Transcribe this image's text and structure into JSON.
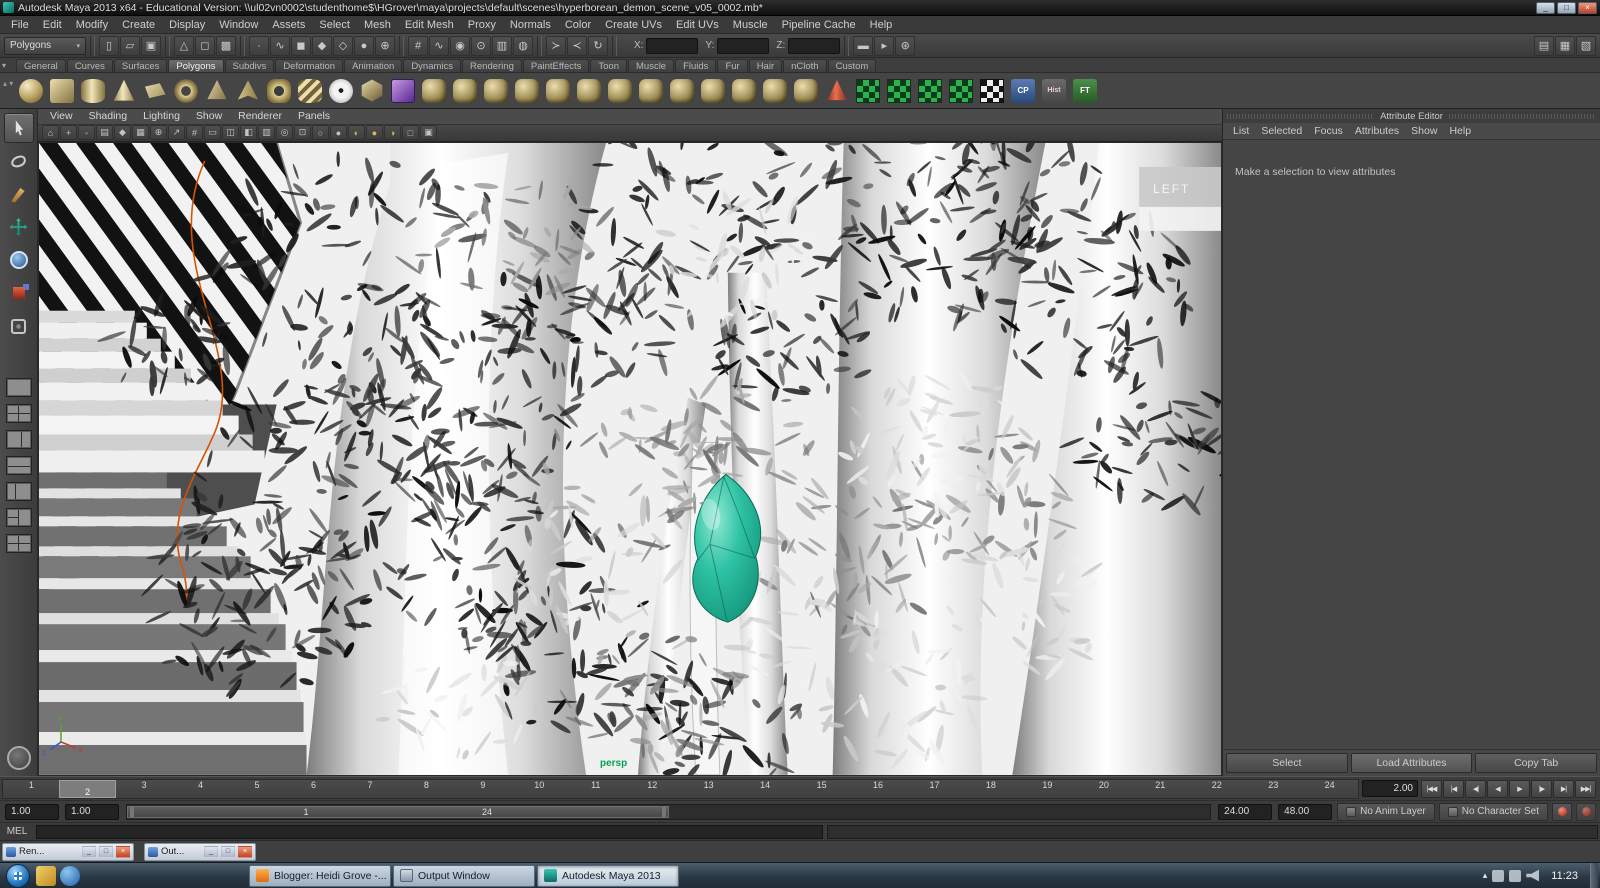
{
  "titlebar": {
    "title": "Autodesk Maya 2013 x64 - Educational Version: \\\\ul02vn0002\\studenthome$\\HGrover\\maya\\projects\\default\\scenes\\hyperborean_demon_scene_v05_0002.mb*",
    "minimize": "_",
    "maximize": "□",
    "close": "×"
  },
  "menubar": {
    "items": [
      "File",
      "Edit",
      "Modify",
      "Create",
      "Display",
      "Window",
      "Assets",
      "Select",
      "Mesh",
      "Edit Mesh",
      "Proxy",
      "Normals",
      "Color",
      "Create UVs",
      "Edit UVs",
      "Muscle",
      "Pipeline Cache",
      "Help"
    ]
  },
  "statusline": {
    "mode": "Polygons",
    "mode_arrow": "▾",
    "groups": {
      "file": [
        {
          "name": "new-scene-icon",
          "glyph": "▯"
        },
        {
          "name": "open-scene-icon",
          "glyph": "▱"
        },
        {
          "name": "save-scene-icon",
          "glyph": "▣"
        }
      ],
      "select": [
        {
          "name": "select-hierarchy-icon",
          "glyph": "△"
        },
        {
          "name": "select-object-icon",
          "glyph": "◻"
        },
        {
          "name": "select-component-icon",
          "glyph": "▩"
        }
      ],
      "mask": [
        {
          "name": "mask-points-icon",
          "glyph": "∙"
        },
        {
          "name": "mask-curves-icon",
          "glyph": "∿"
        },
        {
          "name": "mask-surfaces-icon",
          "glyph": "◼"
        },
        {
          "name": "mask-deformations-icon",
          "glyph": "◆"
        },
        {
          "name": "mask-dynamics-icon",
          "glyph": "◇"
        },
        {
          "name": "mask-rendering-icon",
          "glyph": "●"
        },
        {
          "name": "mask-misc-icon",
          "glyph": "⊕"
        }
      ],
      "snap": [
        {
          "name": "snap-grid-icon",
          "glyph": "#"
        },
        {
          "name": "snap-curve-icon",
          "glyph": "∿"
        },
        {
          "name": "snap-point-icon",
          "glyph": "◉"
        },
        {
          "name": "snap-center-icon",
          "glyph": "⊙"
        },
        {
          "name": "snap-view-plane-icon",
          "glyph": "▥"
        },
        {
          "name": "make-live-icon",
          "glyph": "◍"
        }
      ],
      "history": [
        {
          "name": "input-connections-icon",
          "glyph": "≻"
        },
        {
          "name": "output-connections-icon",
          "glyph": "≺"
        },
        {
          "name": "construction-history-icon",
          "glyph": "↻"
        }
      ],
      "render": [
        {
          "name": "render-current-frame-icon",
          "glyph": "▬"
        },
        {
          "name": "ipr-render-icon",
          "glyph": "▸"
        },
        {
          "name": "render-settings-icon",
          "glyph": "⊛"
        }
      ],
      "panels": [
        {
          "name": "show-attribute-editor-icon",
          "glyph": "▤"
        },
        {
          "name": "show-tool-settings-icon",
          "glyph": "▦"
        },
        {
          "name": "show-channel-box-icon",
          "glyph": "▧"
        }
      ]
    },
    "coords": [
      {
        "label": "X:"
      },
      {
        "label": "Y:"
      },
      {
        "label": "Z:"
      }
    ]
  },
  "shelf": {
    "scroll_glyph": "▴\n▾",
    "tabs": [
      {
        "label": "General"
      },
      {
        "label": "Curves"
      },
      {
        "label": "Surfaces"
      },
      {
        "label": "Polygons",
        "active": "active"
      },
      {
        "label": "Subdivs"
      },
      {
        "label": "Deformation"
      },
      {
        "label": "Animation"
      },
      {
        "label": "Dynamics"
      },
      {
        "label": "Rendering"
      },
      {
        "label": "PaintEffects"
      },
      {
        "label": "Toon"
      },
      {
        "label": "Muscle"
      },
      {
        "label": "Fluids"
      },
      {
        "label": "Fur"
      },
      {
        "label": "Hair"
      },
      {
        "label": "nCloth"
      },
      {
        "label": "Custom"
      }
    ],
    "items": [
      {
        "name": "poly-sphere-icon",
        "style": "s-sphere"
      },
      {
        "name": "poly-cube-icon",
        "style": "s-cube"
      },
      {
        "name": "poly-cylinder-icon",
        "style": "s-cylinder"
      },
      {
        "name": "poly-cone-icon",
        "style": "s-cone"
      },
      {
        "name": "poly-plane-icon",
        "style": "s-plane"
      },
      {
        "name": "poly-torus-icon",
        "style": "s-torus"
      },
      {
        "name": "poly-prism-icon",
        "style": "s-prism"
      },
      {
        "name": "poly-pyramid-icon",
        "style": "s-pyramid"
      },
      {
        "name": "poly-pipe-icon",
        "style": "s-pipe"
      },
      {
        "name": "poly-helix-icon",
        "style": "s-helix"
      },
      {
        "name": "poly-soccer-ball-icon",
        "style": "s-soccer"
      },
      {
        "name": "poly-platonic-icon",
        "style": "s-platonic"
      },
      {
        "name": "interactive-creation-icon",
        "style": "s-purple"
      },
      {
        "name": "combine-icon",
        "style": "s-tool"
      },
      {
        "name": "separate-icon",
        "style": "s-tool"
      },
      {
        "name": "extract-icon",
        "style": "s-tool"
      },
      {
        "name": "boolean-union-icon",
        "style": "s-tool"
      },
      {
        "name": "boolean-difference-icon",
        "style": "s-tool"
      },
      {
        "name": "smooth-icon",
        "style": "s-tool"
      },
      {
        "name": "reduce-icon",
        "style": "s-tool"
      },
      {
        "name": "wedge-icon",
        "style": "s-tool"
      },
      {
        "name": "extrude-icon",
        "style": "s-tool"
      },
      {
        "name": "bridge-icon",
        "style": "s-tool"
      },
      {
        "name": "append-polygon-icon",
        "style": "s-tool"
      },
      {
        "name": "bevel-icon",
        "style": "s-tool"
      },
      {
        "name": "mirror-geometry-icon",
        "style": "s-tool"
      },
      {
        "name": "sculpt-geometry-icon",
        "style": "s-cone-red"
      },
      {
        "name": "uv-planar-mapping-icon",
        "style": "s-checkerg"
      },
      {
        "name": "uv-cylindrical-mapping-icon",
        "style": "s-checkerg"
      },
      {
        "name": "uv-spherical-mapping-icon",
        "style": "s-checkerg"
      },
      {
        "name": "uv-automatic-mapping-icon",
        "style": "s-checkerg"
      },
      {
        "name": "uv-texture-editor-icon",
        "style": "s-checker"
      },
      {
        "name": "cp-icon",
        "style": "s-text-cp",
        "label": "CP"
      },
      {
        "name": "hist-icon",
        "style": "s-text-hist",
        "label": "Hist"
      },
      {
        "name": "ft-icon",
        "style": "s-text-ft",
        "label": "FT"
      }
    ]
  },
  "toolbox": {
    "tools": [
      {
        "name": "select-tool",
        "style": "t-select",
        "active": "active"
      },
      {
        "name": "lasso-tool",
        "style": "t-lasso"
      },
      {
        "name": "paint-select-tool",
        "style": "t-paint"
      },
      {
        "name": "move-tool",
        "style": "t-move"
      },
      {
        "name": "rotate-tool",
        "style": "t-rotate"
      },
      {
        "name": "scale-tool",
        "style": "t-scale"
      },
      {
        "name": "universal-manipulator-tool",
        "style": "t-universal"
      }
    ],
    "layouts": [
      {
        "name": "layout-single-pane",
        "style": "l1"
      },
      {
        "name": "layout-four-pane",
        "style": "l4"
      },
      {
        "name": "layout-two-pane-vertical",
        "style": "l2v"
      },
      {
        "name": "layout-two-pane-horizontal",
        "style": "l2h"
      },
      {
        "name": "layout-persp-outliner",
        "style": "l2v2"
      },
      {
        "name": "layout-three-pane",
        "style": "l3"
      },
      {
        "name": "layout-custom",
        "style": "l4"
      }
    ]
  },
  "viewport": {
    "menus": [
      "View",
      "Shading",
      "Lighting",
      "Show",
      "Renderer",
      "Panels"
    ],
    "toolbar_icons": [
      {
        "name": "view-compass-icon",
        "glyph": "⌂"
      },
      {
        "name": "select-camera-icon",
        "glyph": "+"
      },
      {
        "name": "lock-camera-icon",
        "glyph": "◦"
      },
      {
        "name": "camera-attributes-icon",
        "glyph": "▤"
      },
      {
        "name": "bookmark-icon",
        "glyph": "◆"
      },
      {
        "name": "image-plane-icon",
        "glyph": "▦"
      },
      {
        "name": "pan-zoom-icon",
        "glyph": "⊕"
      },
      {
        "name": "grease-pencil-icon",
        "glyph": "↗"
      },
      {
        "name": "grid-icon",
        "glyph": "#"
      },
      {
        "name": "film-gate-icon",
        "glyph": "▭"
      },
      {
        "name": "resolution-gate-icon",
        "glyph": "◫"
      },
      {
        "name": "gate-mask-icon",
        "glyph": "◧"
      },
      {
        "name": "field-chart-icon",
        "glyph": "▥"
      },
      {
        "name": "safe-action-icon",
        "glyph": "◎"
      },
      {
        "name": "safe-title-icon",
        "glyph": "⊡"
      },
      {
        "name": "wireframe-mode-icon",
        "glyph": "○"
      },
      {
        "name": "shaded-mode-icon",
        "glyph": "●"
      },
      {
        "name": "textured-mode-icon",
        "glyph": "◐",
        "cls": "warm"
      },
      {
        "name": "lighting-icon",
        "glyph": "●",
        "cls": "warm"
      },
      {
        "name": "shadows-icon",
        "glyph": "◑",
        "cls": "warm"
      },
      {
        "name": "xray-icon",
        "glyph": "□"
      },
      {
        "name": "isolate-select-icon",
        "glyph": "▣"
      }
    ],
    "camera_label": "persp",
    "left_tag": "LEFT",
    "axis_y": "y",
    "axis_x": "x",
    "axis_z": "z"
  },
  "attribute_editor": {
    "title": "Attribute Editor",
    "menus": [
      "List",
      "Selected",
      "Focus",
      "Attributes",
      "Show",
      "Help"
    ],
    "message": "Make a selection to view attributes",
    "buttons": [
      "Select",
      "Load Attributes",
      "Copy Tab"
    ]
  },
  "timeline": {
    "ticks": [
      "1",
      "2",
      "3",
      "4",
      "5",
      "6",
      "7",
      "8",
      "9",
      "10",
      "11",
      "12",
      "13",
      "14",
      "15",
      "16",
      "17",
      "18",
      "19",
      "20",
      "21",
      "22",
      "23",
      "24"
    ],
    "current_frame": "2",
    "current_time": "2.00",
    "transport": [
      {
        "name": "go-to-start-button",
        "glyph": "|◀◀"
      },
      {
        "name": "step-back-key-button",
        "glyph": "|◀"
      },
      {
        "name": "step-back-frame-button",
        "glyph": "◀|"
      },
      {
        "name": "play-backwards-button",
        "glyph": "◀"
      },
      {
        "name": "play-forwards-button",
        "glyph": "▶"
      },
      {
        "name": "step-forward-frame-button",
        "glyph": "|▶"
      },
      {
        "name": "step-forward-key-button",
        "glyph": "▶|"
      },
      {
        "name": "go-to-end-button",
        "glyph": "▶▶|"
      }
    ]
  },
  "range_slider": {
    "anim_start": "1.00",
    "playback_start": "1.00",
    "bar_start_label": "1",
    "bar_end_label": "24",
    "playback_end": "24.00",
    "anim_end": "48.00",
    "anim_layer": "No Anim Layer",
    "character_set": "No Character Set"
  },
  "command_line": {
    "label": "MEL"
  },
  "mini_windows": [
    {
      "title": "Ren...",
      "cls": "w1",
      "min": "_",
      "max": "□",
      "close": "×"
    },
    {
      "title": "Out...",
      "cls": "w2",
      "min": "_",
      "max": "□",
      "close": "×"
    }
  ],
  "taskbar": {
    "buttons": [
      {
        "label": "Blogger: Heidi Grove -...",
        "icon_class": "ic-blogger"
      },
      {
        "label": "Output Window",
        "icon_class": "ic-output"
      },
      {
        "label": "Autodesk Maya 2013",
        "icon_class": "ic-maya",
        "active": "active"
      }
    ],
    "tray_chevron": "▴",
    "clock": "11:23"
  }
}
